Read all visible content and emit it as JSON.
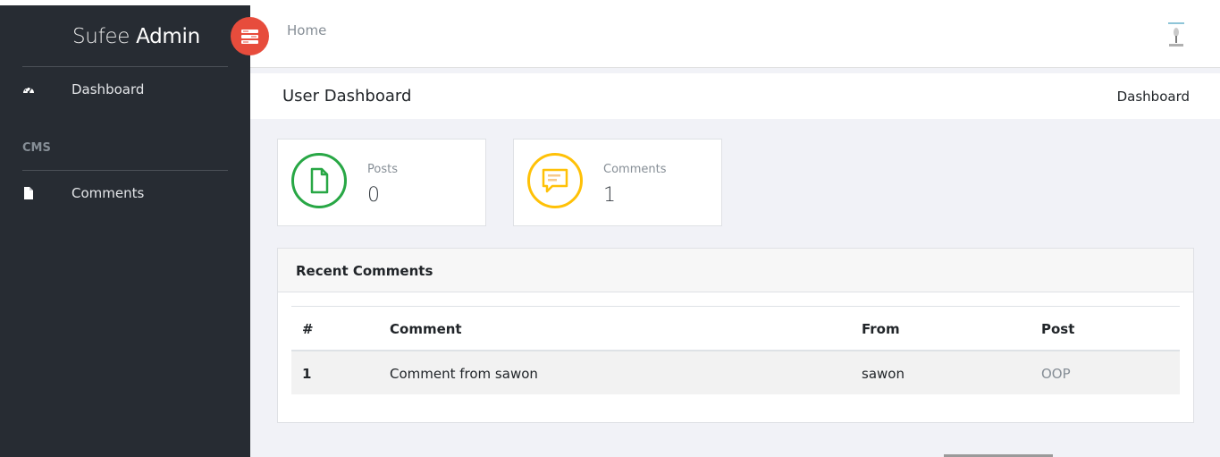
{
  "sidebar": {
    "brand_light": "Sufee",
    "brand_bold": "Admin",
    "items": [
      {
        "label": "Dashboard",
        "icon": "dashboard-icon"
      },
      {
        "label": "Comments",
        "icon": "file-icon"
      }
    ],
    "section_title": "CMS"
  },
  "header": {
    "home_label": "Home",
    "toggle_icon": "menu-toggle-icon",
    "avatar": "user-avatar"
  },
  "page": {
    "title": "User Dashboard",
    "breadcrumb": "Dashboard"
  },
  "stats": [
    {
      "label": "Posts",
      "value": "0",
      "icon": "document-icon",
      "color": "#28a745"
    },
    {
      "label": "Comments",
      "value": "1",
      "icon": "comment-icon",
      "color": "#ffc107"
    }
  ],
  "recent_comments": {
    "title": "Recent Comments",
    "columns": [
      "#",
      "Comment",
      "From",
      "Post"
    ],
    "rows": [
      {
        "num": "1",
        "comment": "Comment from sawon",
        "from": "sawon",
        "post": "OOP"
      }
    ]
  },
  "colors": {
    "sidebar_bg": "#272c33",
    "accent_red": "#e74c3c",
    "success": "#28a745",
    "warning": "#ffc107"
  }
}
